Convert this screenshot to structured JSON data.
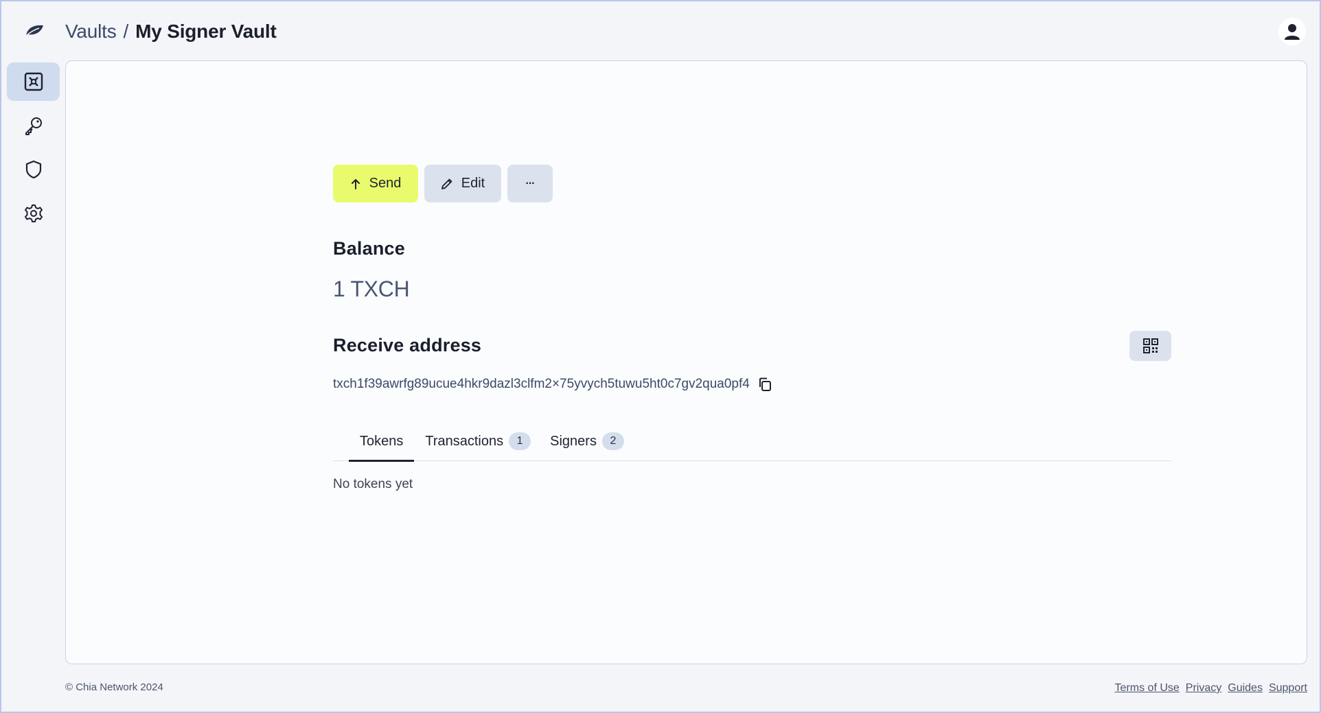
{
  "header": {
    "logo_icon": "leaf-logo-icon",
    "breadcrumb": {
      "parent": "Vaults",
      "separator": "/",
      "current": "My Signer Vault"
    },
    "avatar_icon": "user-avatar-icon"
  },
  "sidebar": {
    "items": [
      {
        "icon": "vault-icon",
        "active": true
      },
      {
        "icon": "key-icon",
        "active": false
      },
      {
        "icon": "shield-icon",
        "active": false
      },
      {
        "icon": "gear-icon",
        "active": false
      }
    ]
  },
  "toolbar": {
    "send_label": "Send",
    "edit_label": "Edit",
    "more_label": "···"
  },
  "balance": {
    "title": "Balance",
    "value": "1 TXCH"
  },
  "receive": {
    "title": "Receive address",
    "address": "txch1f39awrfg89ucue4hkr9dazl3clfm2×75yvych5tuwu5ht0c7gv2qua0pf4"
  },
  "tabs": [
    {
      "label": "Tokens",
      "active": true,
      "badge": ""
    },
    {
      "label": "Transactions",
      "active": false,
      "badge": "1"
    },
    {
      "label": "Signers",
      "active": false,
      "badge": "2"
    }
  ],
  "tokens": {
    "empty_text": "No tokens yet"
  },
  "footer": {
    "copyright": "© Chia Network 2024",
    "links": [
      "Terms of Use",
      "Privacy",
      "Guides",
      "Support"
    ]
  },
  "colors": {
    "send_button": "#e9fb6c",
    "secondary_button": "#dbe2ee",
    "active_nav": "#cfdbef",
    "page_background": "#f3f5f9"
  }
}
